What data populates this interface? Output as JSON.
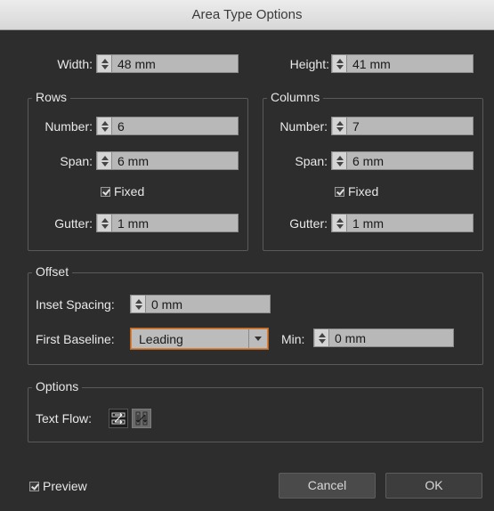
{
  "window": {
    "title": "Area Type Options"
  },
  "size": {
    "width_label": "Width:",
    "width_value": "48 mm",
    "height_label": "Height:",
    "height_value": "41 mm"
  },
  "rows": {
    "title": "Rows",
    "number_label": "Number:",
    "number_value": "6",
    "span_label": "Span:",
    "span_value": "6 mm",
    "fixed_label": "Fixed",
    "fixed_checked": true,
    "gutter_label": "Gutter:",
    "gutter_value": "1 mm"
  },
  "columns": {
    "title": "Columns",
    "number_label": "Number:",
    "number_value": "7",
    "span_label": "Span:",
    "span_value": "6 mm",
    "fixed_label": "Fixed",
    "fixed_checked": true,
    "gutter_label": "Gutter:",
    "gutter_value": "1 mm"
  },
  "offset": {
    "title": "Offset",
    "inset_label": "Inset Spacing:",
    "inset_value": "0 mm",
    "first_baseline_label": "First Baseline:",
    "first_baseline_value": "Leading",
    "min_label": "Min:",
    "min_value": "0 mm"
  },
  "options": {
    "title": "Options",
    "text_flow_label": "Text Flow:",
    "text_flow_icons": [
      "rows-flow-icon",
      "columns-flow-icon"
    ]
  },
  "footer": {
    "preview_label": "Preview",
    "preview_checked": true,
    "cancel_label": "Cancel",
    "ok_label": "OK"
  }
}
